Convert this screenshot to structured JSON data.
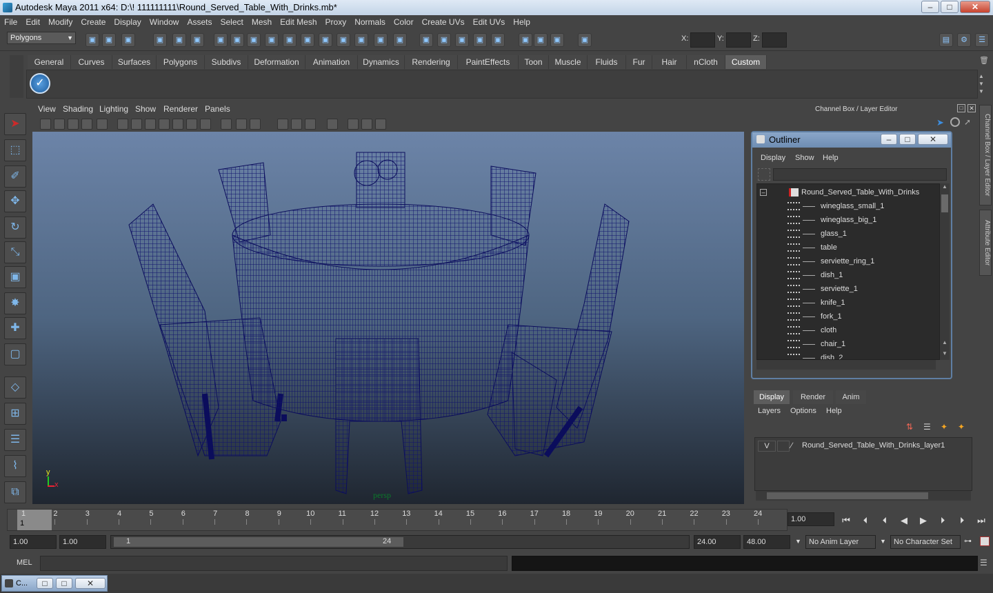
{
  "app": {
    "title": "Autodesk Maya 2011 x64: D:\\! 111111111\\Round_Served_Table_With_Drinks.mb*"
  },
  "menus": [
    "File",
    "Edit",
    "Modify",
    "Create",
    "Display",
    "Window",
    "Assets",
    "Select",
    "Mesh",
    "Edit Mesh",
    "Proxy",
    "Normals",
    "Color",
    "Create UVs",
    "Edit UVs",
    "Help"
  ],
  "toolbar": {
    "mode": "Polygons",
    "x_label": "X:",
    "y_label": "Y:",
    "z_label": "Z:"
  },
  "shelf_tabs": [
    "General",
    "Curves",
    "Surfaces",
    "Polygons",
    "Subdivs",
    "Deformation",
    "Animation",
    "Dynamics",
    "Rendering",
    "PaintEffects",
    "Toon",
    "Muscle",
    "Fluids",
    "Fur",
    "Hair",
    "nCloth",
    "Custom"
  ],
  "panel_menu": [
    "View",
    "Shading",
    "Lighting",
    "Show",
    "Renderer",
    "Panels"
  ],
  "viewport": {
    "camera_label": "persp",
    "axis_x": "x",
    "axis_y": "y"
  },
  "channel_box": {
    "header": "Channel Box / Layer Editor"
  },
  "side_tabs": {
    "channel": "Channel Box / Layer Editor",
    "attribute": "Attribute Editor"
  },
  "outliner": {
    "title": "Outliner",
    "menu": [
      "Display",
      "Show",
      "Help"
    ],
    "root": "Round_Served_Table_With_Drinks",
    "items": [
      "wineglass_small_1",
      "wineglass_big_1",
      "glass_1",
      "table",
      "serviette_ring_1",
      "dish_1",
      "serviette_1",
      "knife_1",
      "fork_1",
      "cloth",
      "chair_1",
      "dish_2"
    ]
  },
  "layers": {
    "tabs": [
      "Display",
      "Render",
      "Anim"
    ],
    "menu": [
      "Layers",
      "Options",
      "Help"
    ],
    "visible_flag": "V",
    "layer_name": "Round_Served_Table_With_Drinks_layer1"
  },
  "timeline": {
    "ticks": [
      "1",
      "2",
      "3",
      "4",
      "5",
      "6",
      "7",
      "8",
      "9",
      "10",
      "11",
      "12",
      "13",
      "14",
      "15",
      "16",
      "17",
      "18",
      "19",
      "20",
      "21",
      "22",
      "23",
      "24"
    ],
    "current_frame_marker": "1",
    "current_time": "1.00"
  },
  "range": {
    "start": "1.00",
    "playback_start": "1.00",
    "slider_start": "1",
    "slider_end": "24",
    "playback_end": "24.00",
    "end": "48.00",
    "anim_layer": "No Anim Layer",
    "character_set": "No Character Set"
  },
  "command_line": {
    "label": "MEL"
  },
  "taskbar": {
    "item": "C..."
  }
}
